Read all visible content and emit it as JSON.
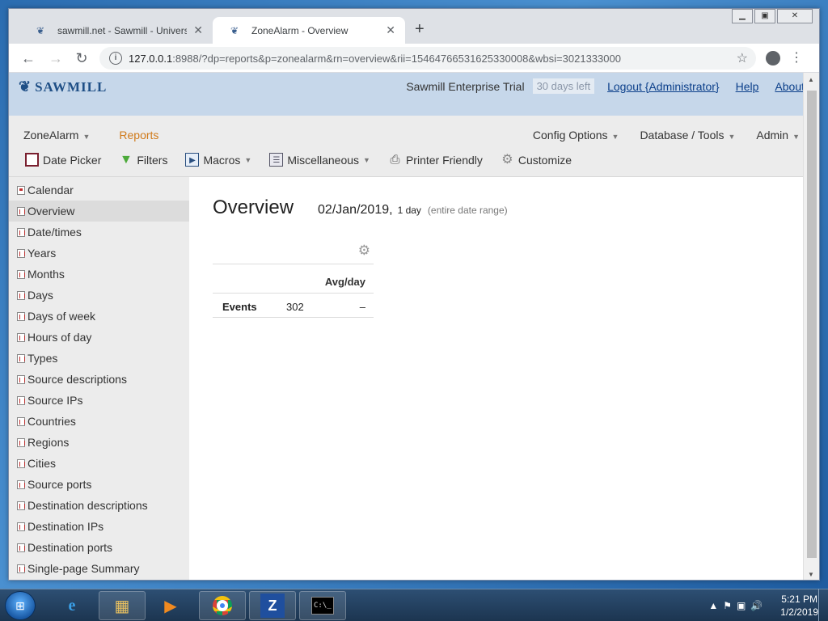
{
  "browser": {
    "tabs": [
      {
        "title": "sawmill.net - Sawmill - Universal",
        "active": false
      },
      {
        "title": "ZoneAlarm - Overview",
        "active": true
      }
    ],
    "new_tab": "+",
    "url_host": "127.0.0.1",
    "url_rest": ":8988/?dp=reports&p=zonealarm&rn=overview&rii=15464766531625330008&wbsi=3021333000"
  },
  "header": {
    "logo": "SAWMILL",
    "trial": "Sawmill Enterprise Trial",
    "days_left": "30 days left",
    "logout": "Logout {Administrator}",
    "help": "Help",
    "about": "About"
  },
  "menu": {
    "profile": "ZoneAlarm",
    "reports": "Reports",
    "config_options": "Config Options",
    "database_tools": "Database / Tools",
    "admin": "Admin"
  },
  "tools": {
    "date_picker": "Date Picker",
    "filters": "Filters",
    "macros": "Macros",
    "miscellaneous": "Miscellaneous",
    "printer_friendly": "Printer Friendly",
    "customize": "Customize"
  },
  "sidebar": {
    "items": [
      {
        "label": "Calendar"
      },
      {
        "label": "Overview"
      },
      {
        "label": "Date/times"
      },
      {
        "label": "Years"
      },
      {
        "label": "Months"
      },
      {
        "label": "Days"
      },
      {
        "label": "Days of week"
      },
      {
        "label": "Hours of day"
      },
      {
        "label": "Types"
      },
      {
        "label": "Source descriptions"
      },
      {
        "label": "Source IPs"
      },
      {
        "label": "Countries"
      },
      {
        "label": "Regions"
      },
      {
        "label": "Cities"
      },
      {
        "label": "Source ports"
      },
      {
        "label": "Destination descriptions"
      },
      {
        "label": "Destination IPs"
      },
      {
        "label": "Destination ports"
      },
      {
        "label": "Single-page Summary"
      }
    ]
  },
  "overview": {
    "title": "Overview",
    "date": "02/Jan/2019,",
    "span": "1 day",
    "range": "(entire date range)",
    "column_header": "Avg/day",
    "row_label": "Events",
    "row_value": "302",
    "row_avg": "–"
  },
  "taskbar": {
    "time": "5:21 PM",
    "date": "1/2/2019"
  }
}
